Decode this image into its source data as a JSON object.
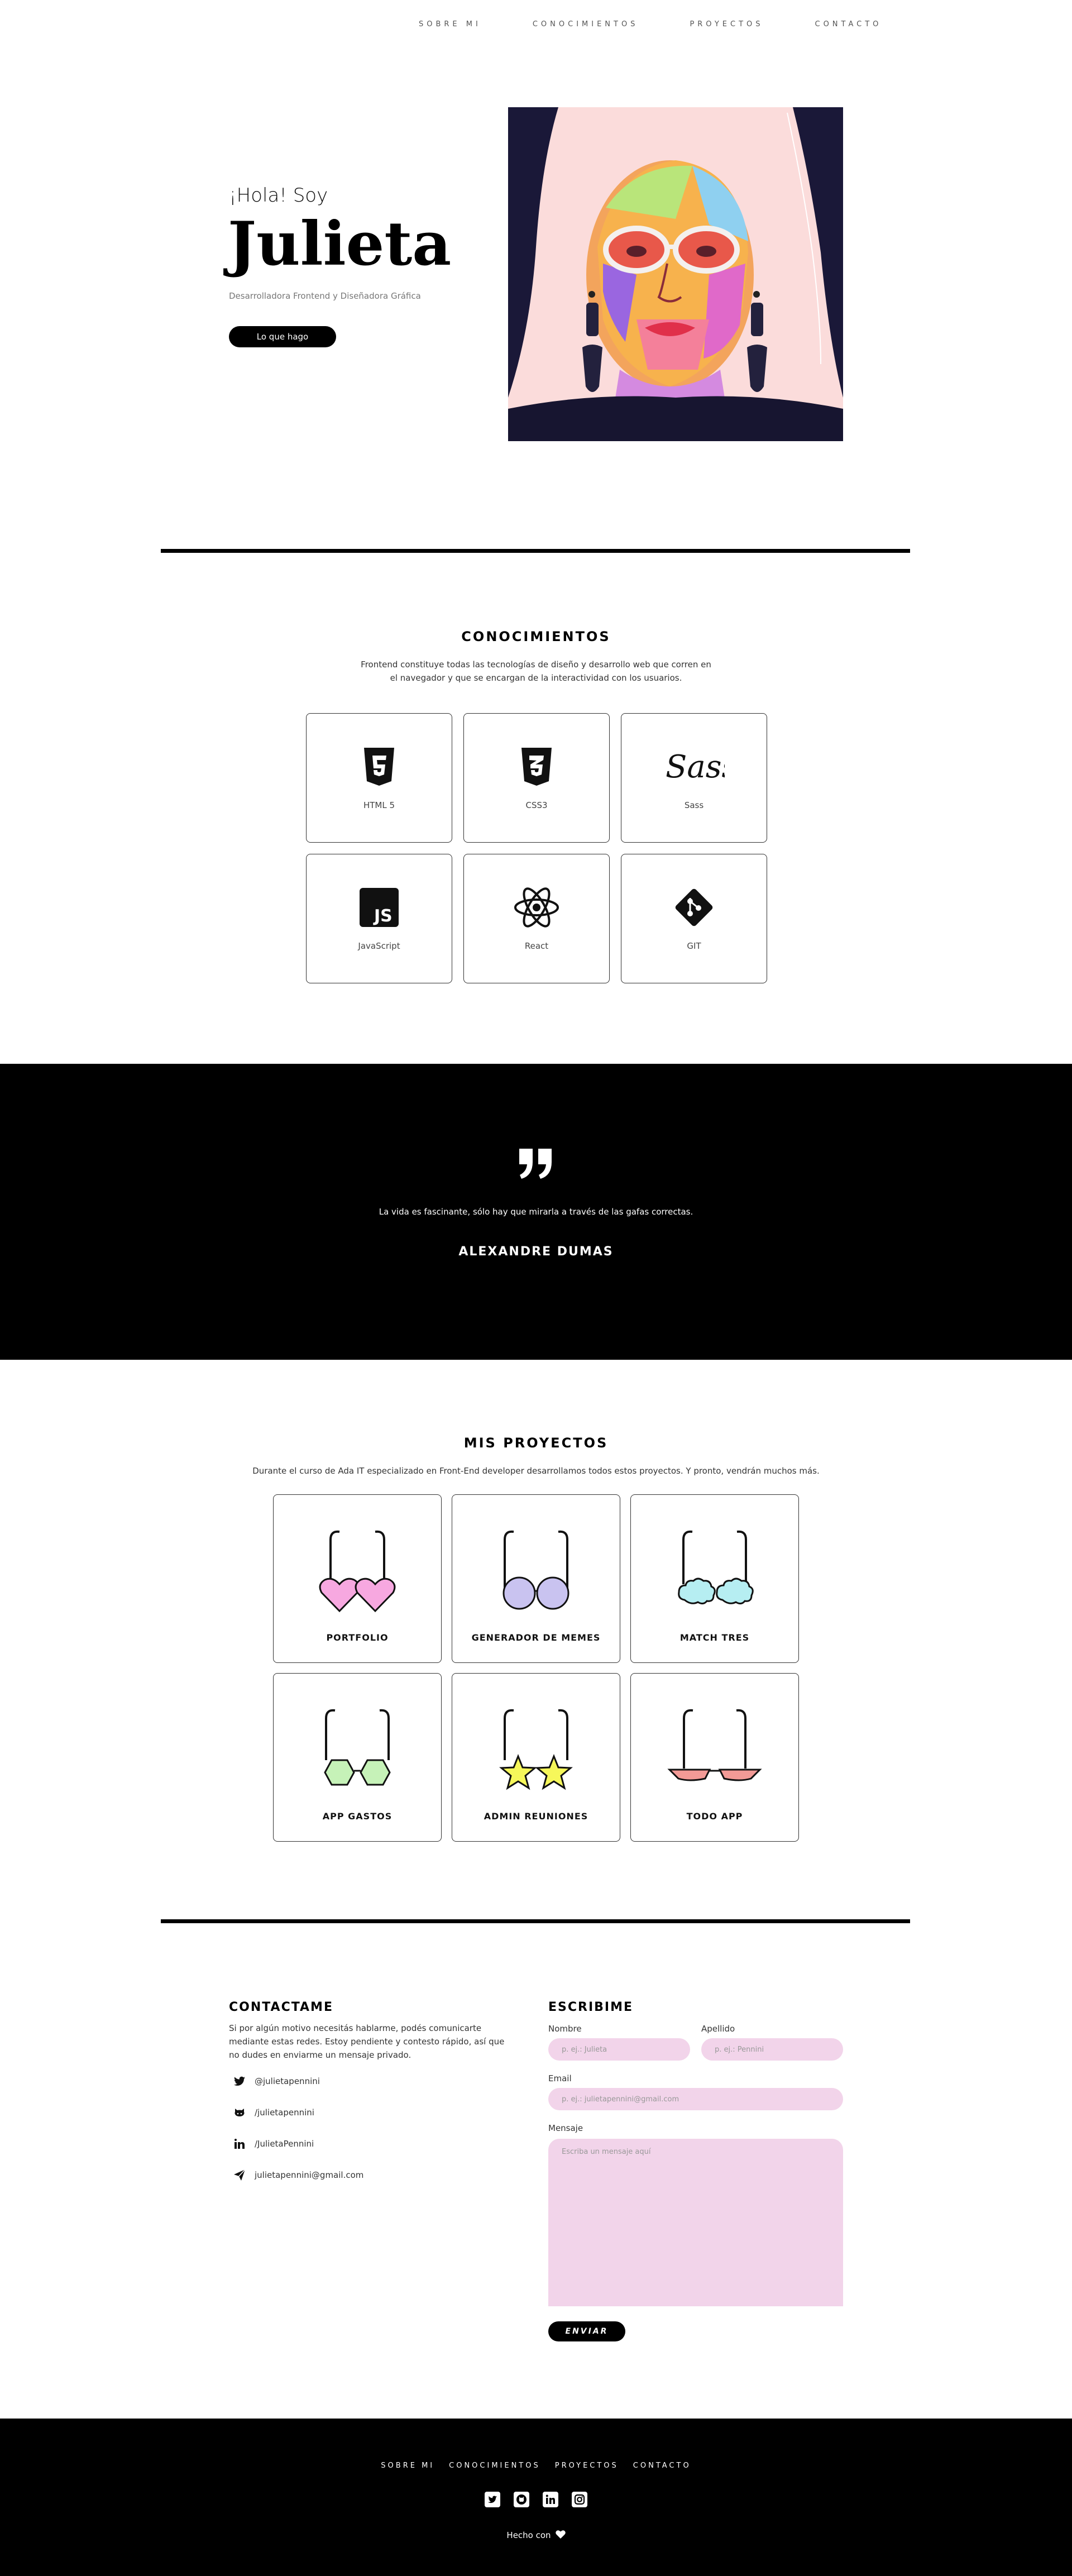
{
  "nav": {
    "items": [
      "SOBRE MI",
      "CONOCIMIENTOS",
      "PROYECTOS",
      "CONTACTO"
    ]
  },
  "hero": {
    "greeting": "¡Hola! Soy",
    "name": "Julieta",
    "subtitle": "Desarrolladora Frontend y Diseñadora Gráfica",
    "button_label": "Lo que hago"
  },
  "skills": {
    "title": "CONOCIMIENTOS",
    "description": "Frontend constituye todas las tecnologías de diseño y desarrollo web que corren en el navegador y que se encargan de la interactividad con los usuarios.",
    "items": [
      {
        "label": "HTML 5",
        "icon": "html5-icon"
      },
      {
        "label": "CSS3",
        "icon": "css3-icon"
      },
      {
        "label": "Sass",
        "icon": "sass-icon"
      },
      {
        "label": "JavaScript",
        "icon": "javascript-icon"
      },
      {
        "label": "React",
        "icon": "react-icon"
      },
      {
        "label": "GIT",
        "icon": "git-icon"
      }
    ]
  },
  "quote": {
    "text": "La vida es fascinante, sólo hay que mirarla a través de las gafas correctas.",
    "author": "ALEXANDRE DUMAS"
  },
  "projects": {
    "title": "MIS PROYECTOS",
    "description": "Durante el curso de Ada IT especializado en Front-End developer desarrollamos todos estos proyectos. Y pronto, vendrán muchos más.",
    "items": [
      {
        "label": "PORTFOLIO",
        "icon": "heart-glasses-icon",
        "color": "#f7a8e0"
      },
      {
        "label": "GENERADOR DE MEMES",
        "icon": "round-glasses-icon",
        "color": "#c9c3f0"
      },
      {
        "label": "MATCH TRES",
        "icon": "cloud-glasses-icon",
        "color": "#b6eef2"
      },
      {
        "label": "APP GASTOS",
        "icon": "hexagon-glasses-icon",
        "color": "#c6f2b8"
      },
      {
        "label": "ADMIN REUNIONES",
        "icon": "star-glasses-icon",
        "color": "#f6f75a"
      },
      {
        "label": "TODO APP",
        "icon": "cateye-glasses-icon",
        "color": "#f29a96"
      }
    ]
  },
  "contact": {
    "title": "CONTACTAME",
    "description": "Si por algún motivo necesitás hablarme, podés comunicarte mediante estas redes. Estoy pendiente y contesto rápido, así que no dudes en enviarme un mensaje privado.",
    "socials": [
      {
        "icon": "twitter-icon",
        "text": "@julietapennini"
      },
      {
        "icon": "github-icon",
        "text": "/julietapennini"
      },
      {
        "icon": "linkedin-icon",
        "text": "/JulietaPennini"
      },
      {
        "icon": "send-icon",
        "text": "julietapennini@gmail.com"
      }
    ]
  },
  "form": {
    "title": "ESCRIBIME",
    "nombre_label": "Nombre",
    "nombre_placeholder": "p. ej.: Julieta",
    "apellido_label": "Apellido",
    "apellido_placeholder": "p. ej.: Pennini",
    "email_label": "Email",
    "email_placeholder": "p. ej.: julietapennini@gmail.com",
    "mensaje_label": "Mensaje",
    "mensaje_placeholder": "Escriba un mensaje aquí",
    "send_label": "ENVIAR"
  },
  "footer": {
    "nav": [
      "SOBRE MI",
      "CONOCIMIENTOS",
      "PROYECTOS",
      "CONTACTO"
    ],
    "icons": [
      "twitter-icon",
      "github-icon",
      "linkedin-icon",
      "instagram-icon"
    ],
    "made_with": "Hecho con"
  }
}
